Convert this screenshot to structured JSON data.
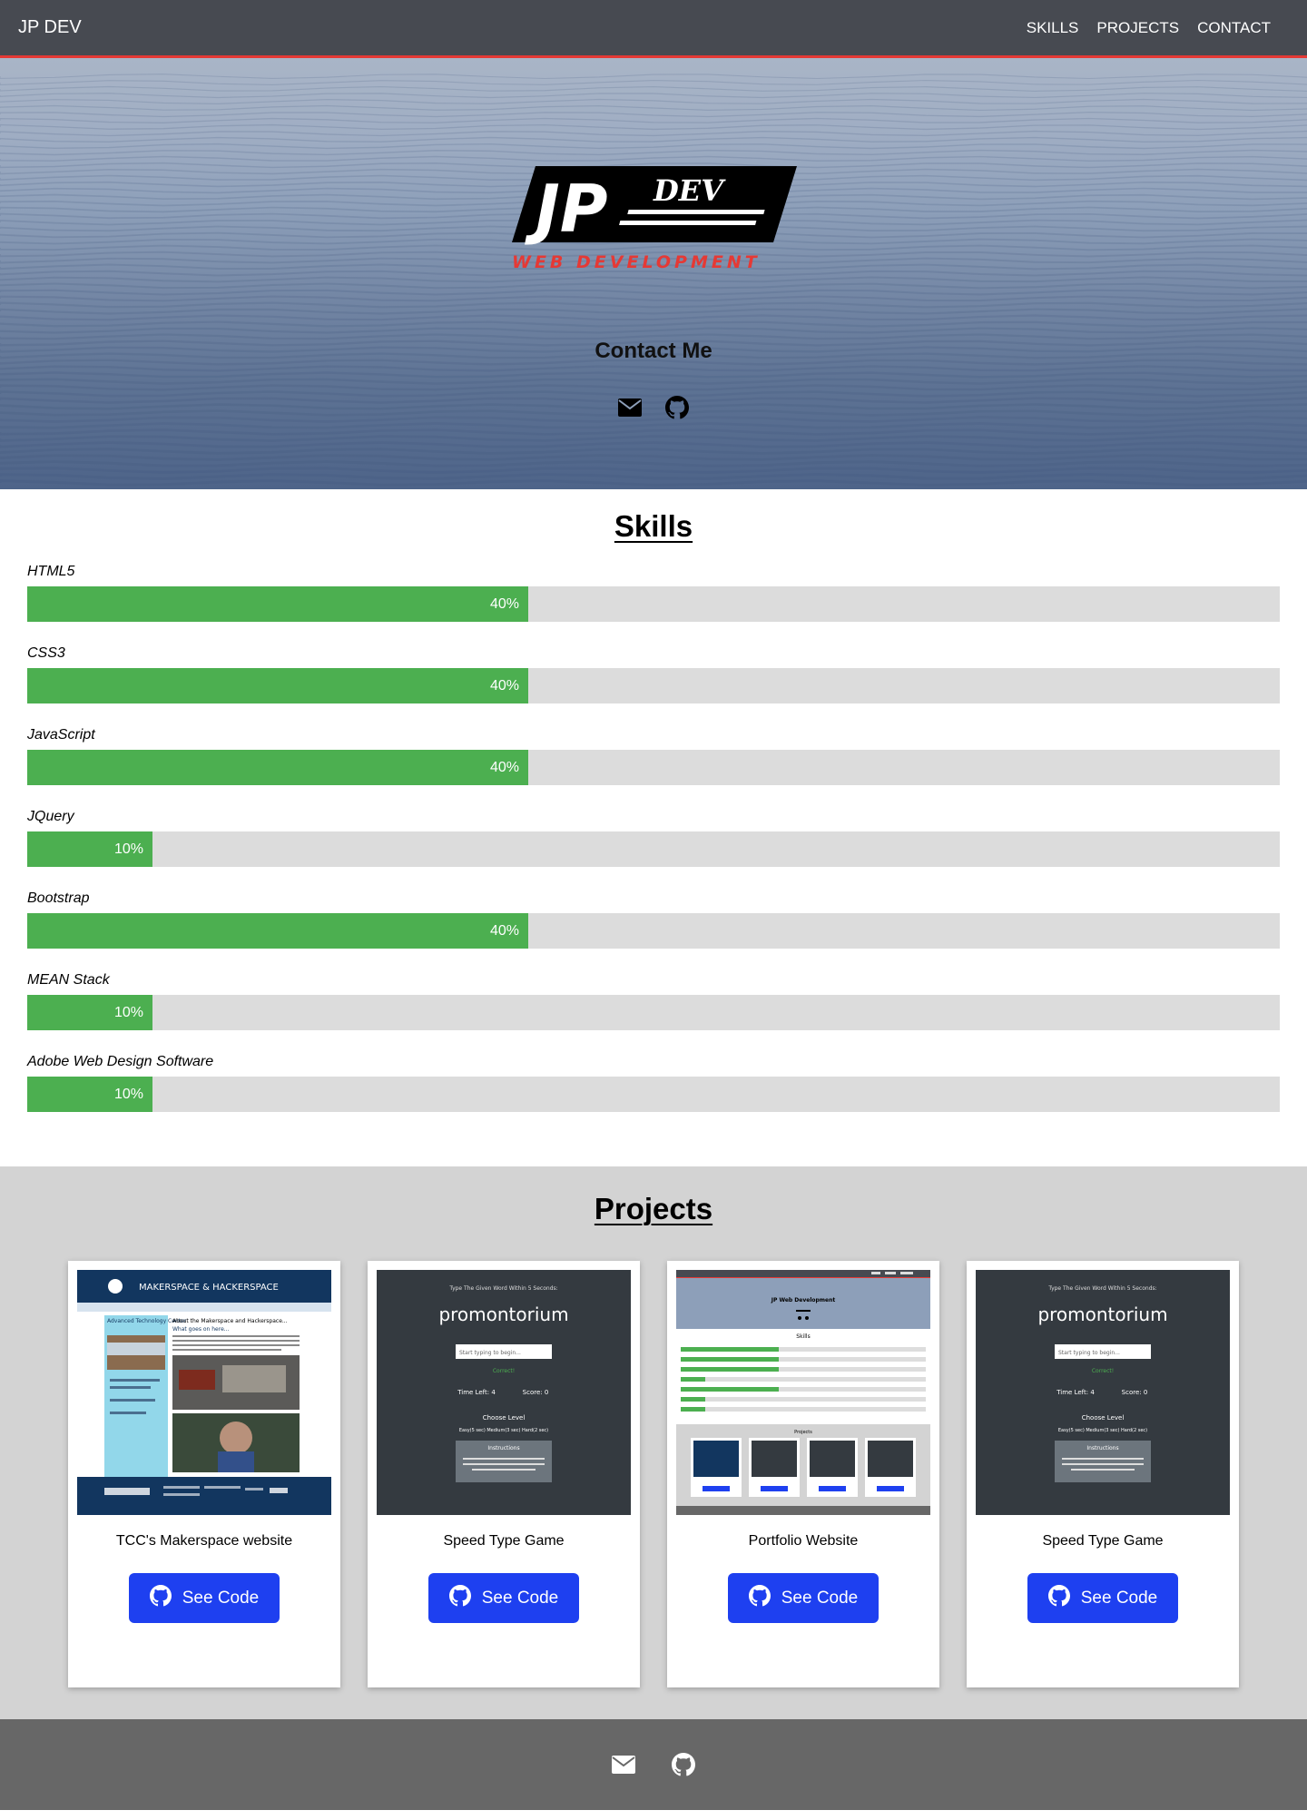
{
  "nav": {
    "brand": "JP DEV",
    "links": [
      "SKILLS",
      "PROJECTS",
      "CONTACT"
    ]
  },
  "hero": {
    "logo": {
      "main": "JP",
      "dev": "DEV",
      "sub": "WEB DEVELOPMENT"
    },
    "contact_title": "Contact Me",
    "icons": [
      "envelope-icon",
      "github-icon"
    ]
  },
  "skills": {
    "title": "Skills",
    "items": [
      {
        "name": "HTML5",
        "percent": 40,
        "label": "40%"
      },
      {
        "name": "CSS3",
        "percent": 40,
        "label": "40%"
      },
      {
        "name": "JavaScript",
        "percent": 40,
        "label": "40%"
      },
      {
        "name": "JQuery",
        "percent": 10,
        "label": "10%"
      },
      {
        "name": "Bootstrap",
        "percent": 40,
        "label": "40%"
      },
      {
        "name": "MEAN Stack",
        "percent": 10,
        "label": "10%"
      },
      {
        "name": "Adobe Web Design Software",
        "percent": 10,
        "label": "10%"
      }
    ]
  },
  "projects": {
    "title": "Projects",
    "cards": [
      {
        "title": "TCC's Makerspace website",
        "button": "See Code",
        "shot": "makerspace",
        "shot_text": {
          "header": "MAKERSPACE & HACKERSPACE",
          "sidebar": "Advanced Technology Center",
          "about": "About the Makerspace and Hackerspace...",
          "what": "What goes on here..."
        }
      },
      {
        "title": "Speed Type Game",
        "button": "See Code",
        "shot": "speedtype",
        "shot_text": {
          "top": "Type The Given Word Within 5 Seconds:",
          "word": "promontorium",
          "placeholder": "Start typing to begin...",
          "correct": "Correct!",
          "time": "Time Left: 4",
          "score": "Score: 0",
          "level": "Choose Level",
          "levels": "Easy(5 sec)  Medium(3 sec)  Hard(2 sec)",
          "instructions": "Instructions",
          "instr_text": "Type each word in the given amount of seconds to score. To play again, just type the current word. Your score will reset."
        }
      },
      {
        "title": "Portfolio Website",
        "button": "See Code",
        "shot": "portfolio",
        "shot_text": {
          "logo": "JP Web Development",
          "skills": "Skills",
          "projects": "Projects"
        }
      },
      {
        "title": "Speed Type Game",
        "button": "See Code",
        "shot": "speedtype",
        "shot_text": {
          "top": "Type The Given Word Within 5 Seconds:",
          "word": "promontorium",
          "placeholder": "Start typing to begin...",
          "correct": "Correct!",
          "time": "Time Left: 4",
          "score": "Score: 0",
          "level": "Choose Level",
          "levels": "Easy(5 sec)  Medium(3 sec)  Hard(2 sec)",
          "instructions": "Instructions",
          "instr_text": "Type each word in the given amount of seconds to score. To play again, just type the current word. Your score will reset."
        }
      }
    ]
  },
  "footer": {
    "icons": [
      "envelope-icon",
      "github-icon"
    ]
  },
  "colors": {
    "nav_bg": "#474a51",
    "nav_accent": "#e53935",
    "skill_fill": "#4caf50",
    "skill_track": "#dcdcdc",
    "button_blue": "#1e40f0",
    "projects_bg": "#d3d3d3",
    "footer_bg": "#676767"
  }
}
